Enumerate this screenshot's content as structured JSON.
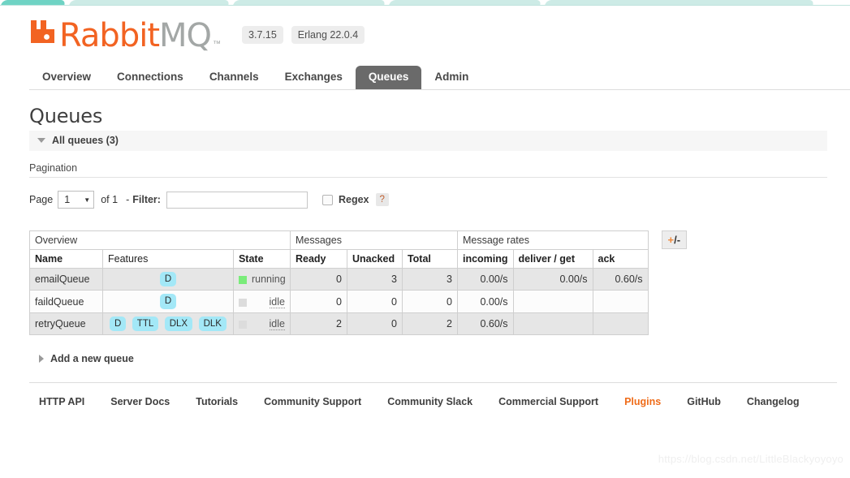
{
  "browser": {
    "tabs": [
      {
        "active": true
      },
      {
        "active": false
      },
      {
        "active": false
      },
      {
        "active": false
      }
    ]
  },
  "brand": {
    "name_primary": "Rabbit",
    "name_secondary": "MQ",
    "trademark": "™",
    "accent_color": "#f26322",
    "secondary_color": "#a3a7a6",
    "logo_icon": "rabbit-logo-icon"
  },
  "versions": {
    "server": "3.7.15",
    "erlang": "Erlang 22.0.4"
  },
  "nav": {
    "items": [
      {
        "label": "Overview",
        "active": false
      },
      {
        "label": "Connections",
        "active": false
      },
      {
        "label": "Channels",
        "active": false
      },
      {
        "label": "Exchanges",
        "active": false
      },
      {
        "label": "Queues",
        "active": true
      },
      {
        "label": "Admin",
        "active": false
      }
    ]
  },
  "page": {
    "title": "Queues",
    "section_label": "All queues (3)",
    "section_expanded": true
  },
  "pagination": {
    "heading": "Pagination",
    "page_label": "Page",
    "page_value": "1",
    "caret": "▼",
    "of_label": "of 1",
    "dash": "-",
    "filter_label": "Filter:",
    "filter_value": "",
    "filter_placeholder": "",
    "regex_label": "Regex",
    "regex_checked": false,
    "help_label": "?"
  },
  "table": {
    "groups": [
      {
        "label": "Overview",
        "span": 3
      },
      {
        "label": "Messages",
        "span": 3
      },
      {
        "label": "Message rates",
        "span": 3
      }
    ],
    "columns": [
      {
        "label": "Name",
        "bold": true,
        "align": "left"
      },
      {
        "label": "Features",
        "bold": false,
        "align": "left"
      },
      {
        "label": "State",
        "bold": true,
        "align": "left"
      },
      {
        "label": "Ready",
        "bold": true,
        "align": "left"
      },
      {
        "label": "Unacked",
        "bold": true,
        "align": "left"
      },
      {
        "label": "Total",
        "bold": true,
        "align": "left"
      },
      {
        "label": "incoming",
        "bold": true,
        "align": "left"
      },
      {
        "label": "deliver / get",
        "bold": true,
        "align": "left"
      },
      {
        "label": "ack",
        "bold": true,
        "align": "left"
      }
    ],
    "toggle_button": {
      "plus": "+",
      "sep": "/",
      "minus": "-"
    },
    "rows": [
      {
        "name": "emailQueue",
        "features": [
          "D"
        ],
        "state": "running",
        "state_kind": "running",
        "ready": "0",
        "unacked": "3",
        "total": "3",
        "incoming": "0.00/s",
        "deliver_get": "0.00/s",
        "ack": "0.60/s"
      },
      {
        "name": "faildQueue",
        "features": [
          "D"
        ],
        "state": "idle",
        "state_kind": "idle",
        "ready": "0",
        "unacked": "0",
        "total": "0",
        "incoming": "0.00/s",
        "deliver_get": "",
        "ack": ""
      },
      {
        "name": "retryQueue",
        "features": [
          "D",
          "TTL",
          "DLX",
          "DLK"
        ],
        "state": "idle",
        "state_kind": "idle",
        "ready": "2",
        "unacked": "0",
        "total": "2",
        "incoming": "0.60/s",
        "deliver_get": "",
        "ack": ""
      }
    ]
  },
  "add_queue": {
    "label": "Add a new queue",
    "expanded": false
  },
  "footer": {
    "links": [
      {
        "label": "HTTP API",
        "accent": false
      },
      {
        "label": "Server Docs",
        "accent": false
      },
      {
        "label": "Tutorials",
        "accent": false
      },
      {
        "label": "Community Support",
        "accent": false
      },
      {
        "label": "Community Slack",
        "accent": false
      },
      {
        "label": "Commercial Support",
        "accent": false
      },
      {
        "label": "Plugins",
        "accent": true
      },
      {
        "label": "GitHub",
        "accent": false
      },
      {
        "label": "Changelog",
        "accent": false
      }
    ]
  },
  "watermark": "https://blog.csdn.net/LittleBlackyoyoyo"
}
